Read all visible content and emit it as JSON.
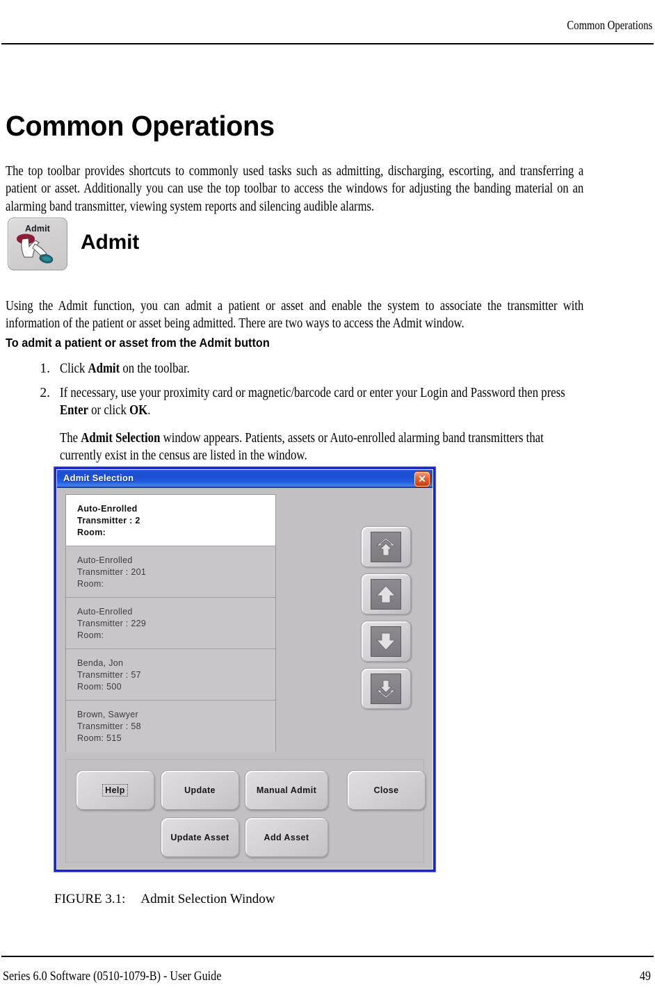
{
  "page_header": {
    "running_head": "Common Operations"
  },
  "chapter": {
    "title": "Common Operations",
    "intro_paragraph": "The top toolbar provides shortcuts to commonly used tasks such as admitting, discharging, escorting, and transferring a patient or asset. Additionally you can use the top toolbar to access the windows for adjusting the banding material on an alarming band transmitter, viewing system reports and silencing audible alarms."
  },
  "admit_section": {
    "toolbar_icon_label": "Admit",
    "heading": "Admit",
    "description": "Using the Admit function, you can admit a patient or asset and enable the system to associate the transmitter with information of the patient or asset being admitted. There are two ways to access the Admit window.",
    "procedure_heading": "To admit a patient or asset from the Admit button",
    "steps": [
      {
        "number": "1.",
        "parts": [
          {
            "text": "Click ",
            "bold": false
          },
          {
            "text": "Admit",
            "bold": true
          },
          {
            "text": " on the toolbar.",
            "bold": false
          }
        ]
      },
      {
        "number": "2.",
        "parts": [
          {
            "text": "If necessary, use your proximity card or magnetic/barcode card or enter your Login and Password then press ",
            "bold": false
          },
          {
            "text": "Enter",
            "bold": true
          },
          {
            "text": " or click ",
            "bold": false
          },
          {
            "text": "OK",
            "bold": true
          },
          {
            "text": ".",
            "bold": false
          }
        ],
        "note_parts": [
          {
            "text": "The ",
            "bold": false
          },
          {
            "text": "Admit Selection",
            "bold": true
          },
          {
            "text": " window appears. Patients, assets or Auto-enrolled alarming band transmitters that currently exist in the census are listed in the window.",
            "bold": false
          }
        ]
      }
    ]
  },
  "dialog": {
    "title": "Admit Selection",
    "close_icon": "close-x-icon",
    "list_items": [
      {
        "name": "Auto-Enrolled",
        "transmitter": "Transmitter : 2",
        "room": "Room:",
        "selected": true
      },
      {
        "name": "Auto-Enrolled",
        "transmitter": "Transmitter : 201",
        "room": "Room:",
        "selected": false
      },
      {
        "name": "Auto-Enrolled",
        "transmitter": "Transmitter : 229",
        "room": "Room:",
        "selected": false
      },
      {
        "name": "Benda, Jon",
        "transmitter": "Transmitter : 57",
        "room": "Room: 500",
        "selected": false
      },
      {
        "name": "Brown, Sawyer",
        "transmitter": "Transmitter : 58",
        "room": "Room: 515",
        "selected": false
      }
    ],
    "scroll_buttons": [
      {
        "icon": "page-up-icon"
      },
      {
        "icon": "arrow-up-icon"
      },
      {
        "icon": "arrow-down-icon"
      },
      {
        "icon": "page-down-icon"
      }
    ],
    "buttons": {
      "help": "Help",
      "update": "Update",
      "manual_admit": "Manual Admit",
      "close": "Close",
      "update_asset": "Update Asset",
      "add_asset": "Add Asset"
    },
    "colors": {
      "titlebar_blue": "#1b4ed4",
      "frame_blue": "#1c26c8",
      "close_red": "#c83c17",
      "face_gray": "#c3c0c4"
    }
  },
  "figure": {
    "label": "FIGURE 3.1:",
    "caption": "Admit Selection Window"
  },
  "footer": {
    "left": "Series 6.0 Software (0510-1079-B) - User Guide",
    "page_number": "49"
  }
}
